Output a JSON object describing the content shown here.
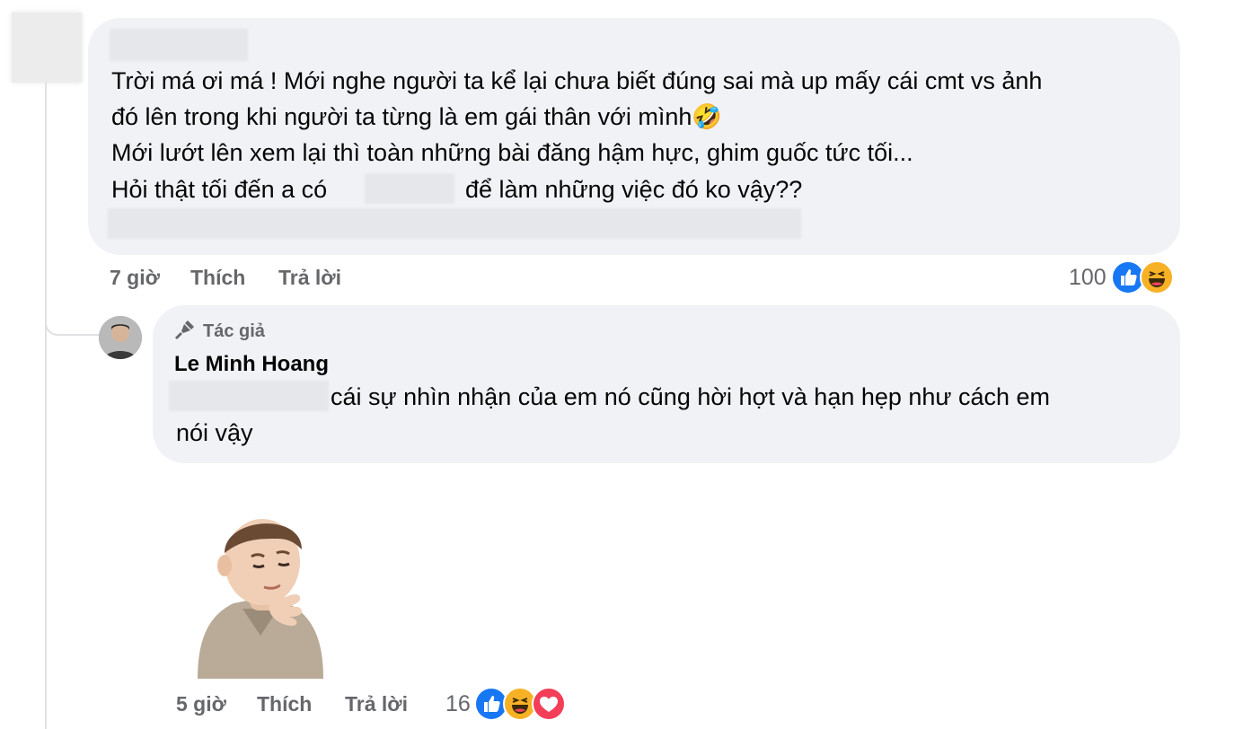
{
  "comment_1": {
    "lines": [
      "Trời má ơi má ! Mới nghe người ta kể lại chưa biết đúng sai mà up mấy cái cmt vs ảnh",
      "đó lên trong khi người ta từng là em gái thân với mình🤣",
      "Mới lướt lên xem lại thì toàn những bài đăng hậm hực, ghim guốc tức tối...",
      "Hỏi thật tối đến a có",
      "để làm những việc đó ko vậy??"
    ],
    "time": "7 giờ",
    "like_label": "Thích",
    "reply_label": "Trả lời",
    "reaction_count": "100",
    "reactions": [
      "like-icon",
      "haha-icon"
    ]
  },
  "comment_2": {
    "badge_label": "Tác giả",
    "author": "Le Minh Hoang",
    "line_1": "cái sự nhìn nhận của em nó cũng hời hợt và hạn hẹp như cách em",
    "line_2": "nói vậy",
    "time": "5 giờ",
    "like_label": "Thích",
    "reply_label": "Trả lời",
    "reaction_count": "16",
    "reactions": [
      "like-icon",
      "haha-icon",
      "love-icon"
    ]
  },
  "colors": {
    "bubble_bg": "#f0f2f5",
    "meta_text": "#65676b",
    "like_blue": "#1877f2",
    "haha_yellow": "#f7b125",
    "love_red": "#f33e58"
  }
}
